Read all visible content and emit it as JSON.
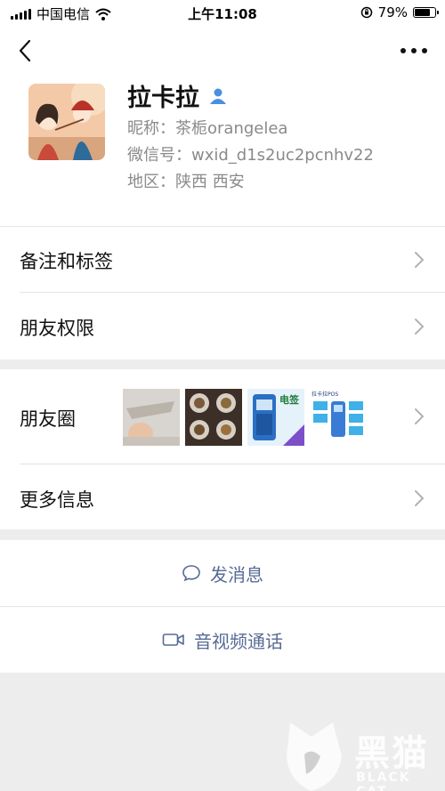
{
  "status_bar": {
    "carrier": "中国电信",
    "time": "上午11:08",
    "battery": "79%",
    "battery_level": 0.79
  },
  "nav": {
    "back_icon": "chevron-left-icon",
    "more_icon": "ellipsis-icon"
  },
  "profile": {
    "name": "拉卡拉",
    "nickname": "昵称：茶栀orangelea",
    "wechat_id": "微信号：wxid_d1s2uc2pcnhv22",
    "region": "地区：陕西 西安",
    "gender_icon": "person-icon"
  },
  "cells": {
    "remarks": "备注和标签",
    "permissions": "朋友权限",
    "moments": "朋友圈",
    "more_info": "更多信息"
  },
  "moments_thumbs": {
    "thumb3_caption": "电签",
    "thumb4_caption": "拉卡拉POS"
  },
  "actions": {
    "message": "发消息",
    "call": "音视频通话"
  },
  "watermark": {
    "title": "黑猫",
    "subtitle": "BLACK CAT"
  },
  "colors": {
    "link_blue": "#576b95",
    "gender_blue": "#4a90e2",
    "background": "#ededed"
  }
}
